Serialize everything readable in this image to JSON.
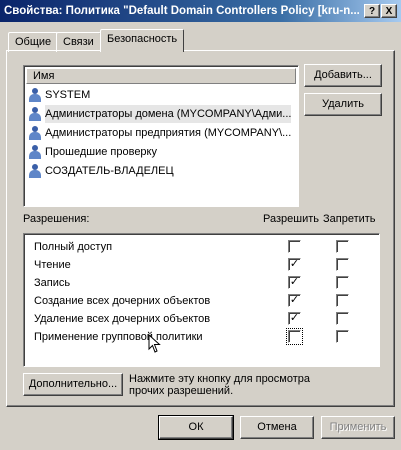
{
  "window": {
    "title": "Свойства: Политика \"Default Domain Controllers Policy [kru-n...",
    "help_button": "?",
    "close_button": "X"
  },
  "tabs": [
    {
      "label": "Общие",
      "active": false
    },
    {
      "label": "Связи",
      "active": false
    },
    {
      "label": "Безопасность",
      "active": true
    }
  ],
  "principals": {
    "column_header": "Имя",
    "items": [
      {
        "name": "SYSTEM",
        "icon": "user-group-icon",
        "selected": false
      },
      {
        "name": "Администраторы домена (MYCOMPANY\\Адми...",
        "icon": "user-group-icon",
        "selected": true
      },
      {
        "name": "Администраторы предприятия (MYCOMPANY\\...",
        "icon": "user-group-icon",
        "selected": false
      },
      {
        "name": "Прошедшие проверку",
        "icon": "user-group-icon",
        "selected": false
      },
      {
        "name": "СОЗДАТЕЛЬ-ВЛАДЕЛЕЦ",
        "icon": "user-group-icon",
        "selected": false
      }
    ],
    "add_button": "Добавить...",
    "remove_button": "Удалить"
  },
  "permissions": {
    "title": "Разрешения:",
    "allow_header": "Разрешить",
    "deny_header": "Запретить",
    "rows": [
      {
        "label": "Полный доступ",
        "allow": false,
        "deny": false
      },
      {
        "label": "Чтение",
        "allow": true,
        "deny": false
      },
      {
        "label": "Запись",
        "allow": true,
        "deny": false
      },
      {
        "label": "Создание всех дочерних объектов",
        "allow": true,
        "deny": false
      },
      {
        "label": "Удаление всех дочерних объектов",
        "allow": true,
        "deny": false
      },
      {
        "label": "Применение групповой политики",
        "allow": false,
        "deny": false
      }
    ]
  },
  "advanced": {
    "button": "Дополнительно...",
    "hint": "Нажмите эту кнопку для просмотра прочих разрешений."
  },
  "footer": {
    "ok": "ОК",
    "cancel": "Отмена",
    "apply": "Применить"
  },
  "colors": {
    "titlebar_start": "#0a246a",
    "titlebar_end": "#a6caf0",
    "dialog_bg": "#d4d0c8"
  }
}
